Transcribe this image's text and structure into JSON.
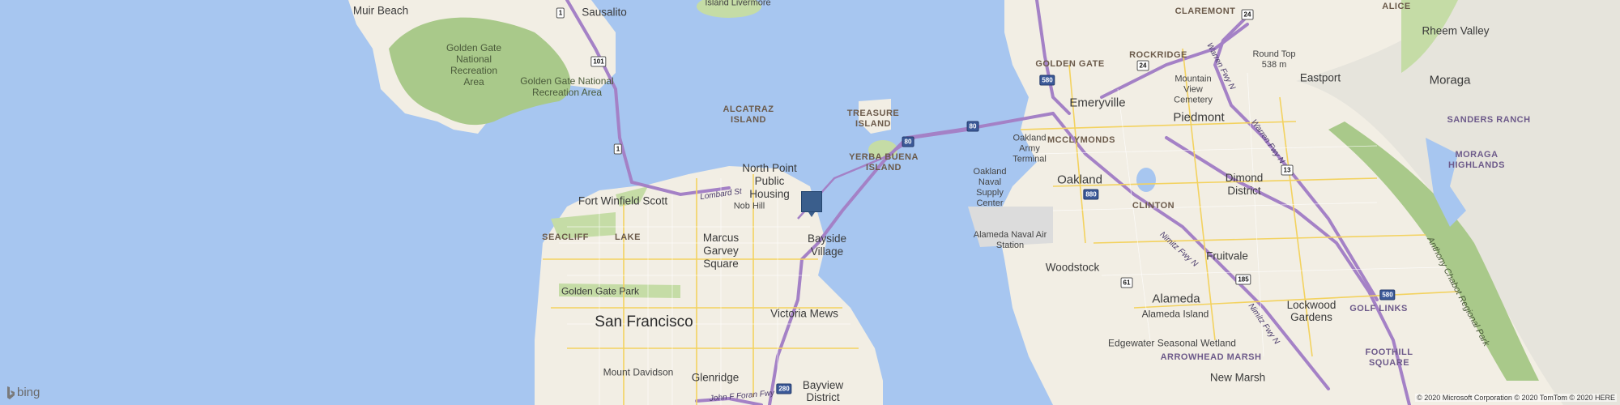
{
  "map": {
    "marker": {
      "icon": "map-pin-icon",
      "color": "#3a5e8c"
    },
    "logo_text": "bing",
    "copyright": "© 2020 Microsoft Corporation © 2020 TomTom © 2020 HERE",
    "colors": {
      "water": "#a7c6f0",
      "land": "#f2eee4",
      "park": "#c5dca6",
      "hill": "#a9c98a",
      "highway": "#a481c6",
      "arterial": "#f3d25f"
    }
  },
  "labels": {
    "sf": "San Francisco",
    "oakland": "Oakland",
    "alameda": "Alameda",
    "emeryville": "Emeryville",
    "piedmont": "Piedmont",
    "moraga": "Moraga",
    "muir_beach": "Muir Beach",
    "sausalito": "Sausalito",
    "island_livermore": "Island Livermore",
    "alice": "ALICE",
    "claremont": "CLAREMONT",
    "rheem_valley": "Rheem Valley",
    "rockridge": "ROCKRIDGE",
    "round_top": "Round Top\n538 m",
    "golden_gate_ggnra": "Golden Gate\nNational\nRecreation\nArea",
    "golden_gate_national": "Golden Gate National\nRecreation Area",
    "golden_gate_hood": "GOLDEN GATE",
    "mountain_view_cemetery": "Mountain\nView\nCemetery",
    "eastport": "Eastport",
    "alcatraz": "ALCATRAZ\nISLAND",
    "treasure_island": "TREASURE\nISLAND",
    "yerba_buena": "YERBA BUENA\nISLAND",
    "mcclymonds": "MCCLYMONDS",
    "oakland_army": "Oakland\nArmy\nTerminal",
    "sanders_ranch": "SANDERS RANCH",
    "moraga_highlands": "MORAGA\nHIGHLANDS",
    "north_point": "North Point\nPublic\nHousing",
    "fort_winfield": "Fort Winfield Scott",
    "lombard": "Lombard St",
    "nob_hill": "Nob Hill",
    "oakland_naval": "Oakland\nNaval\nSupply\nCenter",
    "dimond": "Dimond\nDistrict",
    "seacliff": "SEACLIFF",
    "lake": "LAKE",
    "marcus_garvey": "Marcus\nGarvey\nSquare",
    "bayside": "Bayside\nVillage",
    "clinton": "CLINTON",
    "alameda_naval": "Alameda Naval Air\nStation",
    "anthony_chabot": "Anthony Chabot Regional Park",
    "fruitvale": "Fruitvale",
    "golden_gate_park": "Golden Gate Park",
    "woodstock": "Woodstock",
    "victoria_mews": "Victoria Mews",
    "lockwood": "Lockwood\nGardens",
    "alameda_island": "Alameda Island",
    "golf_links": "GOLF LINKS",
    "edgewater": "Edgewater Seasonal Wetland",
    "foothill_square": "FOOTHILL\nSQUARE",
    "mount_davidson": "Mount Davidson",
    "glenridge": "Glenridge",
    "arrowhead_marsh": "ARROWHEAD MARSH",
    "new_marsh": "New Marsh",
    "bayview": "Bayview\nDistrict",
    "john_f_foran": "John F Foran Fwy",
    "warren_fwy": "Warren Fwy N",
    "warren_fwy_2": "Warren Fwy N",
    "nimitz_1": "Nimitz Fwy N",
    "nimitz_2": "Nimitz Fwy N"
  },
  "shields": {
    "r1_north": "1",
    "r101": "101",
    "r1_south": "1",
    "r580_n": "580",
    "i80_west": "80",
    "i80_east": "80",
    "r24_top": "24",
    "r24_mid": "24",
    "i880": "880",
    "r13": "13",
    "r61": "61",
    "r185": "185",
    "i580_e": "580",
    "i280": "280"
  }
}
